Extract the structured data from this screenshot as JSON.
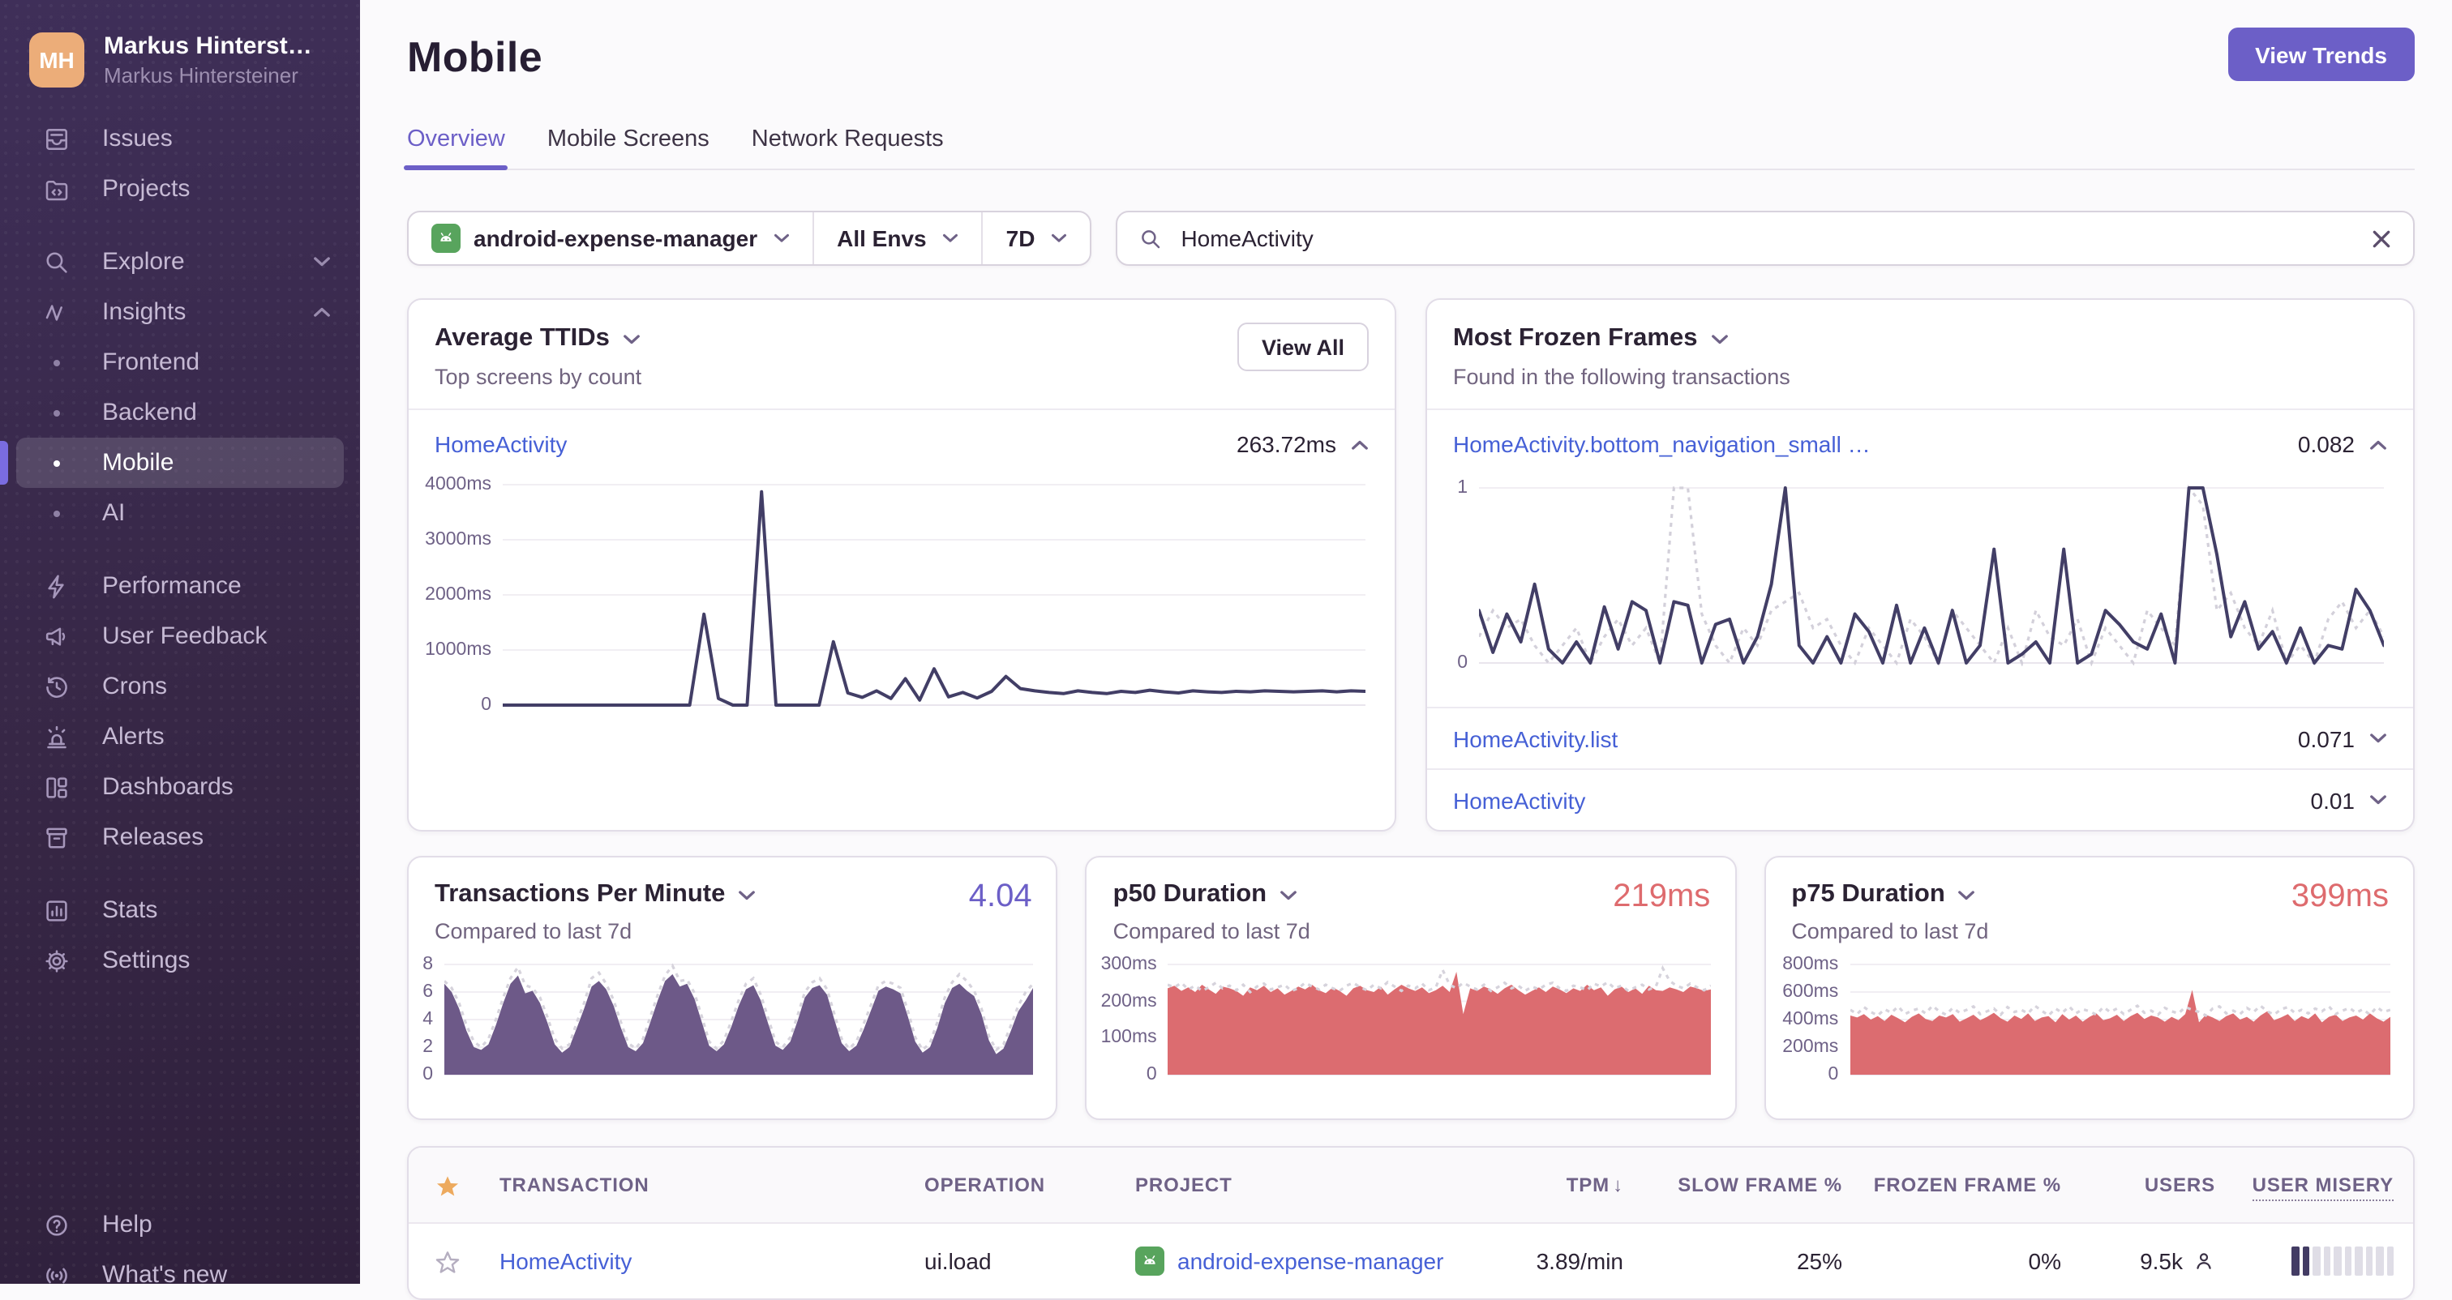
{
  "colors": {
    "accent_purple": "#6C5FC7",
    "link_blue": "#4660D6",
    "danger_red": "#DE6B6E",
    "chart_navy": "#423E66",
    "chart_purple_fill": "#6D5988",
    "chart_red_fill": "#DC6C70",
    "prev_period_gray": "#CFCBD8",
    "sidebar_bg": "#372746",
    "star_gold": "#EDAA5E",
    "android_green": "#58A45D"
  },
  "sidebar": {
    "avatar_initials": "MH",
    "org_name": "Markus Hinterst…",
    "user_name": "Markus Hintersteiner",
    "sections": [
      {
        "items": [
          {
            "icon": "inbox-icon",
            "label": "Issues"
          },
          {
            "icon": "folder-code-icon",
            "label": "Projects"
          }
        ]
      },
      {
        "items": [
          {
            "icon": "search-icon",
            "label": "Explore",
            "chevron": "down"
          },
          {
            "icon": "zigzag-icon",
            "label": "Insights",
            "chevron": "up"
          },
          {
            "bullet": true,
            "label": "Frontend"
          },
          {
            "bullet": true,
            "label": "Backend"
          },
          {
            "bullet": true,
            "label": "Mobile",
            "active": true
          },
          {
            "bullet": true,
            "label": "AI"
          }
        ]
      },
      {
        "items": [
          {
            "icon": "lightning-icon",
            "label": "Performance"
          },
          {
            "icon": "megaphone-icon",
            "label": "User Feedback"
          },
          {
            "icon": "history-clock-icon",
            "label": "Crons"
          },
          {
            "icon": "siren-icon",
            "label": "Alerts"
          },
          {
            "icon": "dashboard-icon",
            "label": "Dashboards"
          },
          {
            "icon": "archive-icon",
            "label": "Releases"
          }
        ]
      },
      {
        "items": [
          {
            "icon": "bar-chart-icon",
            "label": "Stats"
          },
          {
            "icon": "gear-icon",
            "label": "Settings"
          }
        ]
      }
    ],
    "footer_items": [
      {
        "icon": "question-circle-icon",
        "label": "Help"
      },
      {
        "icon": "broadcast-icon",
        "label": "What's new"
      }
    ]
  },
  "header": {
    "title": "Mobile",
    "view_trends_label": "View Trends",
    "tabs": [
      {
        "label": "Overview",
        "active": true
      },
      {
        "label": "Mobile Screens",
        "active": false
      },
      {
        "label": "Network Requests",
        "active": false
      }
    ]
  },
  "filters": {
    "project": "android-expense-manager",
    "environment": "All Envs",
    "period": "7D",
    "search_value": "HomeActivity"
  },
  "cards": {
    "ttid": {
      "title": "Average TTIDs",
      "subtitle": "Top screens by count",
      "view_all_label": "View All",
      "rows": [
        {
          "name": "HomeActivity",
          "value": "263.72ms",
          "expanded": true
        }
      ]
    },
    "frozen": {
      "title": "Most Frozen Frames",
      "subtitle": "Found in the following transactions",
      "rows": [
        {
          "name": "HomeActivity.bottom_navigation_small …",
          "value": "0.082",
          "expanded": true
        },
        {
          "name": "HomeActivity.list",
          "value": "0.071",
          "expanded": false
        },
        {
          "name": "HomeActivity",
          "value": "0.01",
          "expanded": false
        }
      ]
    },
    "tpm": {
      "title": "Transactions Per Minute",
      "value": "4.04",
      "subtitle": "Compared to last 7d"
    },
    "p50": {
      "title": "p50 Duration",
      "value": "219ms",
      "subtitle": "Compared to last 7d"
    },
    "p75": {
      "title": "p75 Duration",
      "value": "399ms",
      "subtitle": "Compared to last 7d"
    }
  },
  "table": {
    "columns": [
      {
        "key": "star",
        "label": "",
        "align": "center"
      },
      {
        "key": "transaction",
        "label": "TRANSACTION",
        "align": "left"
      },
      {
        "key": "operation",
        "label": "OPERATION",
        "align": "left"
      },
      {
        "key": "project",
        "label": "PROJECT",
        "align": "left"
      },
      {
        "key": "tpm",
        "label": "TPM",
        "align": "right",
        "sorted": "desc",
        "sort_icon": "↓"
      },
      {
        "key": "slow",
        "label": "SLOW FRAME %",
        "align": "right"
      },
      {
        "key": "frozen",
        "label": "FROZEN FRAME %",
        "align": "right"
      },
      {
        "key": "users",
        "label": "USERS",
        "align": "right"
      },
      {
        "key": "misery",
        "label": "USER MISERY",
        "align": "right",
        "underlined": true
      }
    ],
    "rows": [
      {
        "starred": false,
        "transaction": "HomeActivity",
        "operation": "ui.load",
        "project": "android-expense-manager",
        "tpm": "3.89/min",
        "slow_frame_pct": "25%",
        "frozen_frame_pct": "0%",
        "users": "9.5k",
        "misery_filled": 2,
        "misery_total": 10
      }
    ]
  },
  "chart_data": [
    {
      "id": "ttid-homeactivity",
      "type": "line",
      "title": "Average TTIDs - HomeActivity",
      "unit": "ms",
      "ylim": [
        0,
        4000
      ],
      "yticks": [
        "4000ms",
        "3000ms",
        "2000ms",
        "1000ms",
        "0"
      ],
      "grid": true,
      "legend": "none",
      "color": "#423E66",
      "values": [
        0,
        0,
        0,
        0,
        0,
        0,
        0,
        0,
        0,
        0,
        0,
        0,
        0,
        0,
        1650,
        120,
        0,
        0,
        3870,
        0,
        0,
        0,
        0,
        1150,
        220,
        140,
        260,
        120,
        480,
        90,
        660,
        150,
        230,
        130,
        250,
        520,
        300,
        260,
        230,
        210,
        260,
        230,
        210,
        250,
        230,
        270,
        240,
        220,
        260,
        240,
        230,
        250,
        240,
        260,
        250,
        240,
        250,
        260,
        240,
        260,
        250
      ]
    },
    {
      "id": "frozen-frames-bottom-navigation",
      "type": "line",
      "title": "Most Frozen Frames - HomeActivity.bottom_navigation_small …",
      "ylim": [
        0,
        1
      ],
      "yticks": [
        "1",
        "0"
      ],
      "grid": true,
      "legend": "none",
      "color": "#423E66",
      "prev_color": "#D3D0DA",
      "values": [
        0.3,
        0.06,
        0.28,
        0.12,
        0.45,
        0.08,
        0,
        0.12,
        0,
        0.32,
        0.08,
        0.35,
        0.3,
        0,
        0.35,
        0.33,
        0,
        0.22,
        0.25,
        0,
        0.15,
        0.45,
        1.0,
        0.1,
        0,
        0.15,
        0,
        0.28,
        0.18,
        0,
        0.33,
        0,
        0.2,
        0,
        0.3,
        0,
        0.1,
        0.65,
        0,
        0.05,
        0.12,
        0,
        0.65,
        0,
        0.05,
        0.3,
        0.22,
        0.12,
        0.08,
        0.28,
        0,
        1.0,
        1.0,
        0.62,
        0.15,
        0.35,
        0.08,
        0.18,
        0,
        0.2,
        0,
        0.1,
        0.08,
        0.42,
        0.3,
        0.1
      ],
      "prev_values": [
        0.15,
        0.3,
        0.2,
        0.25,
        0.1,
        0,
        0.1,
        0.2,
        0,
        0.15,
        0.25,
        0.1,
        0.2,
        0,
        1.0,
        1.0,
        0.28,
        0.1,
        0,
        0.2,
        0.1,
        0.3,
        0.35,
        0.4,
        0.2,
        0.25,
        0.1,
        0,
        0.2,
        0.1,
        0,
        0.25,
        0.15,
        0,
        0.3,
        0.2,
        0.1,
        0,
        0.2,
        0,
        0.3,
        0.15,
        0.1,
        0.25,
        0,
        0.2,
        0.1,
        0,
        0.3,
        0.2,
        0.1,
        1.0,
        0.9,
        0.3,
        0.4,
        0.2,
        0.1,
        0.3,
        0,
        0.1,
        0,
        0.25,
        0.35,
        0.2,
        0.3,
        0.15
      ]
    },
    {
      "id": "transactions-per-minute",
      "type": "area",
      "title": "Transactions Per Minute",
      "current_value": "4.04",
      "ylim": [
        0,
        8
      ],
      "yticks": [
        "8",
        "6",
        "4",
        "2",
        "0"
      ],
      "grid": true,
      "legend": "none",
      "color": "#6D5988",
      "prev_color": "#D6D3DC",
      "values": [
        6.6,
        6.0,
        4.8,
        3.2,
        2.0,
        1.8,
        2.2,
        3.6,
        5.2,
        6.6,
        7.2,
        5.9,
        6.1,
        5.2,
        3.8,
        2.2,
        1.6,
        2.0,
        3.4,
        4.8,
        6.4,
        6.8,
        6.2,
        5.0,
        3.4,
        2.0,
        1.7,
        2.3,
        3.8,
        5.4,
        6.8,
        7.3,
        6.4,
        6.6,
        5.5,
        3.8,
        2.1,
        1.7,
        2.2,
        3.5,
        5.0,
        6.2,
        6.5,
        5.4,
        3.7,
        2.1,
        1.8,
        2.4,
        3.9,
        5.6,
        6.3,
        6.5,
        5.8,
        4.0,
        2.3,
        1.7,
        2.1,
        3.3,
        4.7,
        6.1,
        6.4,
        6.2,
        5.9,
        4.2,
        2.4,
        1.6,
        2.0,
        3.4,
        5.2,
        6.3,
        6.6,
        6.1,
        5.7,
        4.4,
        2.5,
        1.5,
        1.9,
        3.2,
        4.6,
        5.4,
        6.3
      ],
      "prev_values": [
        6.8,
        6.3,
        5.2,
        3.6,
        2.4,
        2.0,
        2.6,
        4.0,
        5.6,
        7.0,
        7.8,
        6.5,
        6.3,
        5.6,
        4.2,
        2.6,
        1.9,
        2.2,
        3.8,
        5.2,
        7.0,
        7.4,
        6.6,
        5.4,
        3.8,
        2.3,
        1.9,
        2.6,
        4.2,
        5.8,
        7.2,
        7.9,
        6.8,
        6.9,
        5.9,
        4.2,
        2.4,
        1.9,
        2.5,
        3.9,
        5.4,
        6.6,
        7.0,
        5.8,
        4.1,
        2.4,
        2.0,
        2.7,
        4.3,
        6.0,
        6.7,
        7.0,
        6.2,
        4.4,
        2.6,
        1.9,
        2.4,
        3.7,
        5.1,
        6.5,
        6.8,
        6.6,
        6.3,
        4.6,
        2.7,
        1.8,
        2.3,
        3.8,
        5.6,
        6.7,
        7.3,
        6.8,
        6.1,
        4.8,
        2.8,
        1.8,
        2.2,
        3.6,
        5.0,
        6.0,
        6.6
      ]
    },
    {
      "id": "p50-duration",
      "type": "area",
      "title": "p50 Duration",
      "current_value": "219ms",
      "unit": "ms",
      "ylim": [
        0,
        300
      ],
      "yticks": [
        "300ms",
        "200ms",
        "100ms",
        "0"
      ],
      "grid": true,
      "legend": "none",
      "color": "#DC6C70",
      "prev_color": "#D6D3DC",
      "values": [
        235,
        242,
        228,
        238,
        225,
        245,
        232,
        220,
        240,
        235,
        228,
        215,
        238,
        230,
        242,
        225,
        235,
        218,
        228,
        240,
        232,
        245,
        230,
        222,
        238,
        228,
        215,
        235,
        242,
        230,
        225,
        240,
        218,
        232,
        245,
        235,
        228,
        238,
        222,
        230,
        242,
        225,
        280,
        165,
        235,
        228,
        240,
        232,
        220,
        235,
        245,
        230,
        218,
        228,
        238,
        225,
        240,
        232,
        222,
        235,
        228,
        245,
        230,
        238,
        215,
        232,
        240,
        225,
        235,
        220,
        242,
        230,
        228,
        238,
        232,
        225,
        240,
        235,
        228,
        232
      ],
      "prev_values": [
        245,
        238,
        250,
        232,
        242,
        228,
        238,
        250,
        235,
        242,
        230,
        245,
        225,
        240,
        248,
        232,
        238,
        245,
        228,
        235,
        250,
        240,
        232,
        245,
        235,
        228,
        242,
        250,
        238,
        230,
        245,
        235,
        252,
        240,
        228,
        242,
        235,
        248,
        230,
        238,
        285,
        245,
        235,
        250,
        240,
        232,
        245,
        228,
        238,
        250,
        235,
        242,
        228,
        240,
        232,
        245,
        250,
        235,
        228,
        242,
        238,
        230,
        248,
        240,
        252,
        235,
        242,
        228,
        238,
        245,
        232,
        240,
        290,
        255,
        242,
        235,
        248,
        238,
        230,
        242
      ]
    },
    {
      "id": "p75-duration",
      "type": "area",
      "title": "p75 Duration",
      "current_value": "399ms",
      "unit": "ms",
      "ylim": [
        0,
        800
      ],
      "yticks": [
        "800ms",
        "600ms",
        "400ms",
        "200ms",
        "0"
      ],
      "grid": true,
      "legend": "none",
      "color": "#DC6C70",
      "prev_color": "#D6D3DC",
      "values": [
        430,
        415,
        440,
        400,
        425,
        390,
        435,
        410,
        380,
        420,
        445,
        405,
        390,
        430,
        415,
        440,
        385,
        410,
        435,
        395,
        420,
        450,
        410,
        385,
        430,
        405,
        445,
        390,
        415,
        425,
        380,
        440,
        400,
        430,
        385,
        420,
        445,
        395,
        410,
        435,
        390,
        425,
        450,
        405,
        430,
        415,
        385,
        420,
        395,
        440,
        615,
        380,
        435,
        415,
        390,
        425,
        445,
        400,
        420,
        385,
        430,
        460,
        395,
        415,
        440,
        390,
        425,
        405,
        445,
        380,
        420,
        435,
        390,
        415,
        430,
        400,
        445,
        410,
        385,
        420
      ],
      "prev_values": [
        470,
        440,
        490,
        455,
        430,
        475,
        450,
        495,
        440,
        465,
        480,
        445,
        500,
        460,
        435,
        485,
        450,
        470,
        495,
        440,
        460,
        480,
        435,
        490,
        455,
        470,
        445,
        500,
        465,
        430,
        480,
        450,
        495,
        445,
        475,
        460,
        435,
        490,
        455,
        480,
        440,
        470,
        500,
        450,
        465,
        435,
        485,
        460,
        445,
        490,
        470,
        455,
        430,
        480,
        495,
        445,
        465,
        440,
        485,
        455,
        500,
        460,
        435,
        475,
        490,
        450,
        470,
        445,
        480,
        460,
        495,
        440,
        465,
        485,
        450,
        475,
        435,
        490,
        455,
        470
      ]
    }
  ]
}
